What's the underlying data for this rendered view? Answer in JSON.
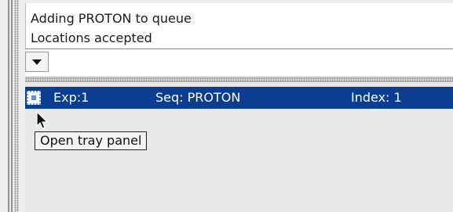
{
  "log": {
    "lines": [
      "Adding PROTON to queue",
      "Locations accepted"
    ]
  },
  "queue": {
    "rows": [
      {
        "exp": "Exp:1",
        "seq": "Seq: PROTON",
        "index": "Index: 1",
        "icon": "tray-icon"
      }
    ]
  },
  "tooltip": {
    "text": "Open tray panel"
  },
  "colors": {
    "selected_row": "#0b3d91",
    "background": "#ececec"
  }
}
